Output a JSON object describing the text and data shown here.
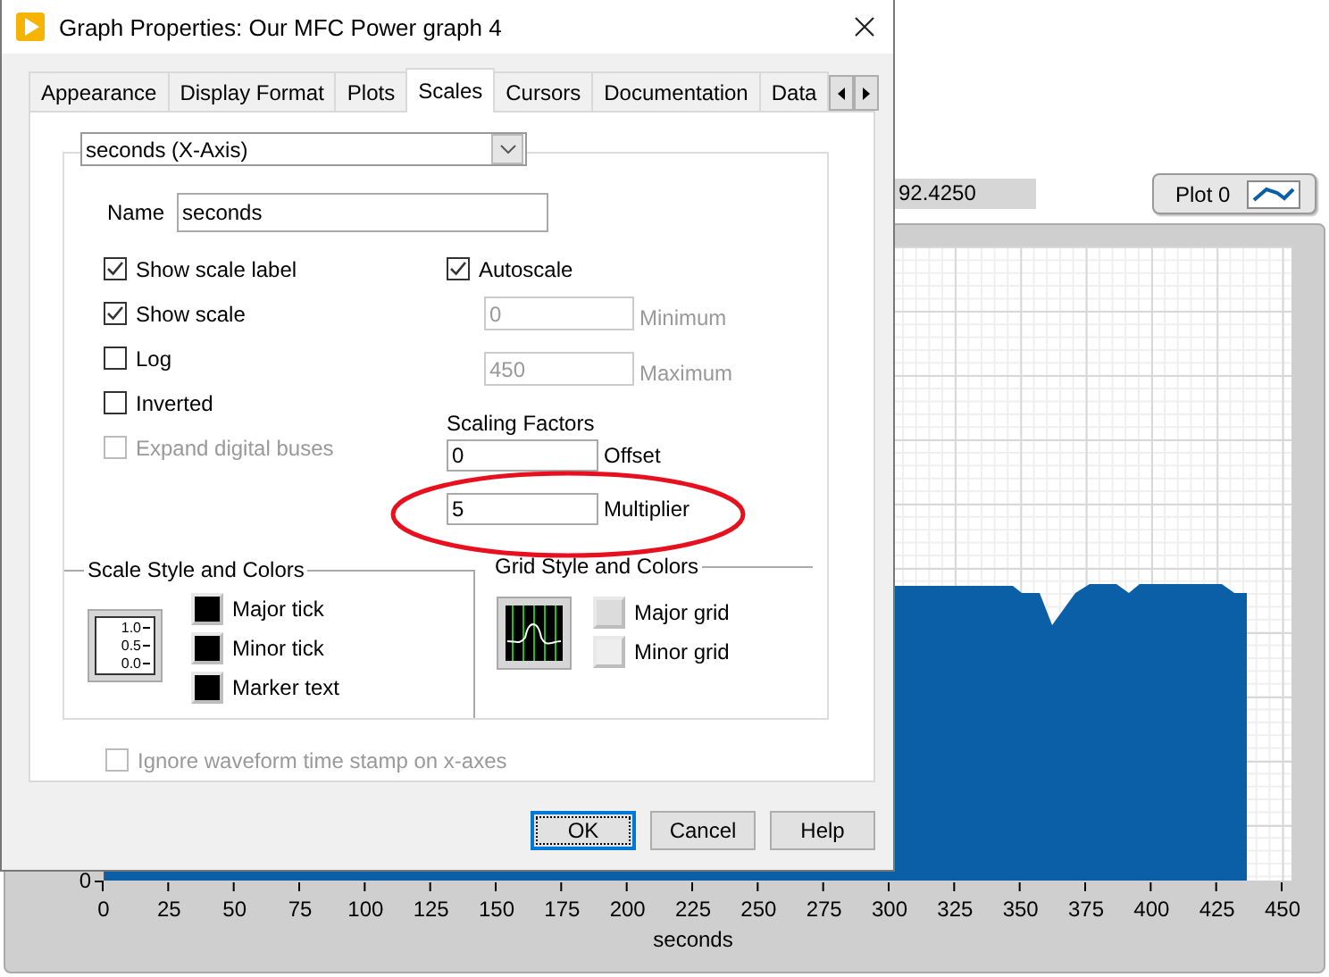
{
  "graph": {
    "readout": "92.4250",
    "legend": {
      "label": "Plot 0"
    },
    "y_axis": {
      "ticks": [
        "0"
      ]
    },
    "x_axis": {
      "label": "seconds",
      "ticks": [
        "0",
        "25",
        "50",
        "75",
        "100",
        "125",
        "150",
        "175",
        "200",
        "225",
        "250",
        "275",
        "300",
        "325",
        "350",
        "375",
        "400",
        "425",
        "450"
      ]
    }
  },
  "dialog": {
    "title": "Graph Properties: Our MFC Power graph 4",
    "tabs": [
      {
        "label": "Appearance",
        "selected": false
      },
      {
        "label": "Display Format",
        "selected": false
      },
      {
        "label": "Plots",
        "selected": false
      },
      {
        "label": "Scales",
        "selected": true
      },
      {
        "label": "Cursors",
        "selected": false
      },
      {
        "label": "Documentation",
        "selected": false
      },
      {
        "label": "Data",
        "selected": false
      }
    ],
    "axis_select": {
      "value": "seconds (X-Axis)"
    },
    "name": {
      "label": "Name",
      "value": "seconds"
    },
    "options": [
      {
        "label": "Show scale label",
        "checked": true,
        "disabled": false
      },
      {
        "label": "Show scale",
        "checked": true,
        "disabled": false
      },
      {
        "label": "Log",
        "checked": false,
        "disabled": false
      },
      {
        "label": "Inverted",
        "checked": false,
        "disabled": false
      },
      {
        "label": "Expand digital buses",
        "checked": false,
        "disabled": true
      }
    ],
    "autoscale": {
      "label": "Autoscale",
      "checked": true
    },
    "range": [
      {
        "value": "0",
        "label": "Minimum",
        "disabled": true
      },
      {
        "value": "450",
        "label": "Maximum",
        "disabled": true
      }
    ],
    "scaling_factors": {
      "title": "Scaling Factors",
      "fields": [
        {
          "value": "0",
          "label": "Offset"
        },
        {
          "value": "5",
          "label": "Multiplier"
        }
      ]
    },
    "annotation": {
      "kind": "ellipse"
    },
    "scale_style": {
      "title": "Scale Style and Colors",
      "preview_labels": [
        "1.0",
        "0.5",
        "0.0"
      ],
      "items": [
        {
          "label": "Major tick",
          "color": "#000000"
        },
        {
          "label": "Minor tick",
          "color": "#000000"
        },
        {
          "label": "Marker text",
          "color": "#000000"
        }
      ]
    },
    "grid_style": {
      "title": "Grid Style and Colors",
      "items": [
        {
          "label": "Major grid",
          "color": "#dcdcdc"
        },
        {
          "label": "Minor grid",
          "color": "#eeeeee"
        }
      ]
    },
    "ignore_timestamp": {
      "label": "Ignore waveform time stamp on x-axes",
      "checked": false,
      "disabled": true
    },
    "buttons": [
      {
        "label": "OK",
        "default": true
      },
      {
        "label": "Cancel",
        "default": false
      },
      {
        "label": "Help",
        "default": false
      }
    ]
  }
}
